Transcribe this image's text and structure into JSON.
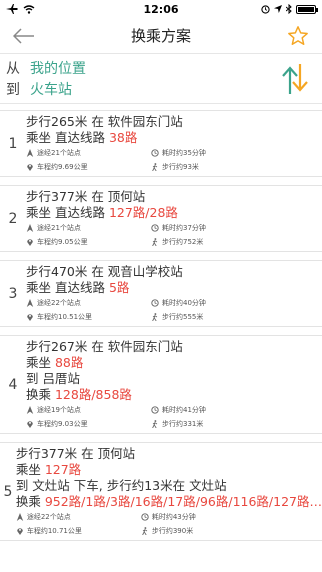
{
  "status": {
    "time": "12:06",
    "battery_text": ""
  },
  "nav": {
    "title": "换乘方案"
  },
  "route": {
    "from_prefix": "从",
    "from_place": "我的位置",
    "to_prefix": "到",
    "to_place": "火车站"
  },
  "colors": {
    "accent": "#3ba38b",
    "highlight": "#e8483f",
    "star": "#f5a623"
  },
  "plans": [
    {
      "index": "1",
      "walk": "步行265米 在 软件园东门站",
      "ride": "乘坐 直达线路 ",
      "ride_line": "38路",
      "stops": "途经21个站点",
      "time": "耗时约35分钟",
      "distance": "车程约9.69公里",
      "walk_dist": "步行约93米"
    },
    {
      "index": "2",
      "walk": "步行377米 在 顶何站",
      "ride": "乘坐 直达线路 ",
      "ride_line": "127路/28路",
      "stops": "途经21个站点",
      "time": "耗时约37分钟",
      "distance": "车程约9.05公里",
      "walk_dist": "步行约752米"
    },
    {
      "index": "3",
      "walk": "步行470米 在 观音山学校站",
      "ride": "乘坐 直达线路 ",
      "ride_line": "5路",
      "stops": "途经22个站点",
      "time": "耗时约40分钟",
      "distance": "车程约10.51公里",
      "walk_dist": "步行约555米"
    },
    {
      "index": "4",
      "walk": "步行267米 在 软件园东门站",
      "ride": "乘坐 ",
      "ride_line": "88路",
      "transfer_at": "到 吕厝站",
      "transfer_prefix": "换乘 ",
      "transfer_line": "128路/858路",
      "stops": "途经19个站点",
      "time": "耗时约41分钟",
      "distance": "车程约9.03公里",
      "walk_dist": "步行约331米"
    },
    {
      "index": "5",
      "walk": "步行377米 在 顶何站",
      "ride": "乘坐 ",
      "ride_line": "127路",
      "transfer_at": "到 文灶站 下车, 步行约13米在 文灶站",
      "transfer_prefix": "换乘 ",
      "transfer_line": "952路/1路/3路/16路/17路/96路/116路/127路…",
      "stops": "途经22个站点",
      "time": "耗时约43分钟",
      "distance": "车程约10.71公里",
      "walk_dist": "步行约390米"
    }
  ]
}
